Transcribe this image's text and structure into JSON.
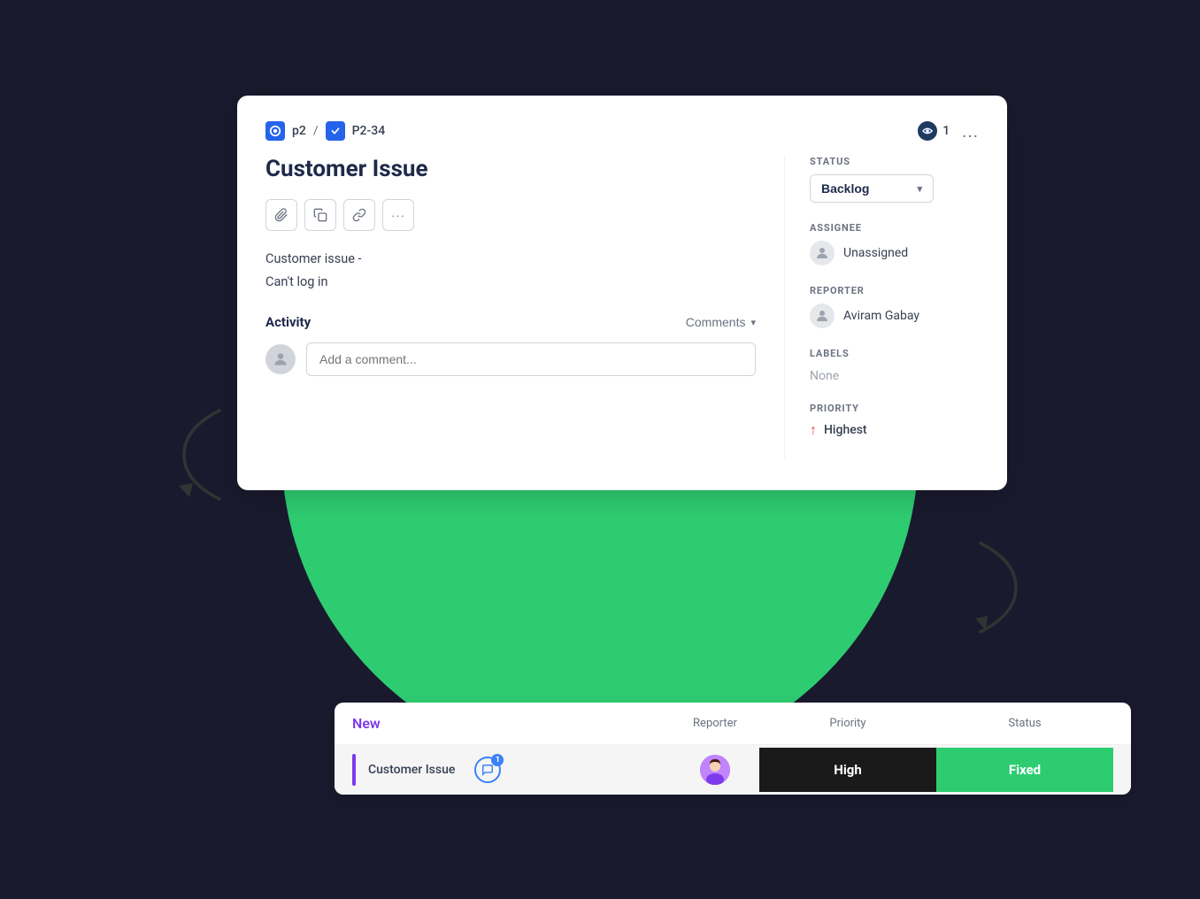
{
  "breadcrumb": {
    "project": "p2",
    "separator": "/",
    "issue_id": "P2-34"
  },
  "watch": {
    "count": "1"
  },
  "more": "...",
  "issue": {
    "title": "Customer Issue",
    "description_line1": "Customer issue -",
    "description_line2": "Can't log in"
  },
  "toolbar": {
    "attach_label": "📎",
    "copy_label": "📋",
    "link_label": "🔗",
    "more_label": "···"
  },
  "activity": {
    "label": "Activity",
    "filter_label": "Comments",
    "comment_placeholder": "Add a comment..."
  },
  "sidebar": {
    "status_label": "STATUS",
    "status_value": "Backlog",
    "assignee_label": "ASSIGNEE",
    "assignee_value": "Unassigned",
    "reporter_label": "REPORTER",
    "reporter_value": "Aviram Gabay",
    "labels_label": "LABELS",
    "labels_value": "None",
    "priority_label": "PRIORITY",
    "priority_value": "Highest"
  },
  "table": {
    "section_label": "New",
    "col_reporter": "Reporter",
    "col_priority": "Priority",
    "col_status": "Status",
    "row": {
      "issue_name": "Customer Issue",
      "comment_count": "1",
      "priority_value": "High",
      "status_value": "Fixed"
    }
  },
  "colors": {
    "accent_green": "#2ecc71",
    "accent_purple": "#7c3aed",
    "priority_bg": "#1a1a1a",
    "status_bg": "#2ecc71"
  }
}
